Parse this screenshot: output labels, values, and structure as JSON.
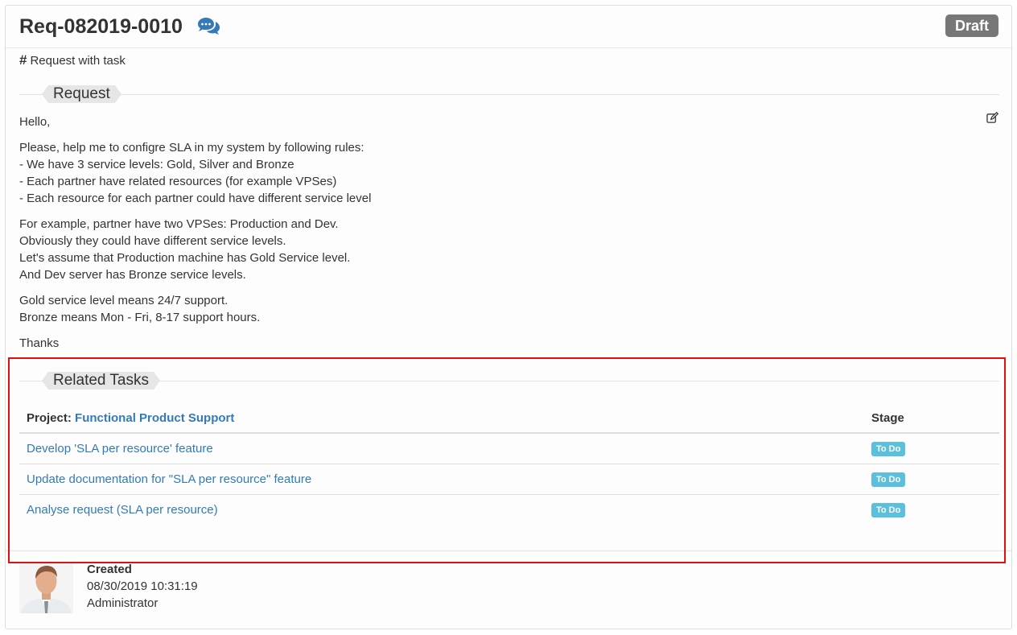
{
  "header": {
    "title": "Req-082019-0010",
    "status_badge": "Draft"
  },
  "subtitle": {
    "hash": "#",
    "text": "Request with task"
  },
  "request": {
    "section_label": "Request",
    "greeting": "Hello,",
    "para1": [
      "Please, help me to configre SLA in my system by following rules:",
      "- We have 3 service levels: Gold, Silver and Bronze",
      "- Each partner have related resources (for example VPSes)",
      "- Each resource for each partner could have different service level"
    ],
    "para2": [
      "For example, partner have two VPSes: Production and Dev.",
      "Obviously they could have different service levels.",
      "Let's assume that Production machine has Gold Service level.",
      "And Dev server has Bronze service levels."
    ],
    "para3": [
      "Gold service level means 24/7 support.",
      "Bronze means Mon - Fri, 8-17 support hours."
    ],
    "closing": "Thanks"
  },
  "related_tasks": {
    "section_label": "Related Tasks",
    "project_label": "Project:",
    "project_name": "Functional Product Support",
    "stage_header": "Stage",
    "tasks": [
      {
        "name": "Develop 'SLA per resource' feature",
        "stage": "To Do"
      },
      {
        "name": "Update documentation for \"SLA per resource\" feature",
        "stage": "To Do"
      },
      {
        "name": "Analyse request (SLA per resource)",
        "stage": "To Do"
      }
    ]
  },
  "created": {
    "label": "Created",
    "datetime": "08/30/2019 10:31:19",
    "author": "Administrator"
  },
  "colors": {
    "link": "#337ab7",
    "todo_badge": "#5bc0de",
    "draft_badge": "#777777",
    "highlight": "#e01010"
  }
}
